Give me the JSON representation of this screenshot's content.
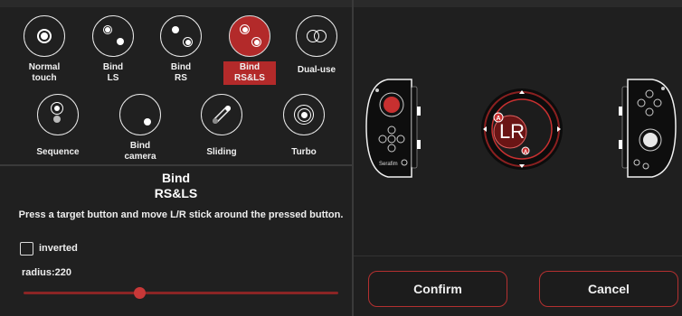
{
  "modes": [
    {
      "id": "normal-touch",
      "label_lines": [
        "Normal",
        "touch"
      ]
    },
    {
      "id": "bind-ls",
      "label_lines": [
        "Bind",
        "LS"
      ]
    },
    {
      "id": "bind-rs",
      "label_lines": [
        "Bind",
        "RS"
      ]
    },
    {
      "id": "bind-rs-ls",
      "label_lines": [
        "Bind",
        "RS&LS"
      ],
      "selected": true
    },
    {
      "id": "dual-use",
      "label_lines": [
        "Dual-use"
      ]
    },
    {
      "id": "sequence",
      "label_lines": [
        "Sequence"
      ]
    },
    {
      "id": "bind-camera",
      "label_lines": [
        "Bind",
        "camera"
      ]
    },
    {
      "id": "sliding",
      "label_lines": [
        "Sliding"
      ]
    },
    {
      "id": "turbo",
      "label_lines": [
        "Turbo"
      ]
    }
  ],
  "description": {
    "title_line1": "Bind",
    "title_line2": "RS&LS",
    "text": "Press a target button and move L/R stick around the pressed button."
  },
  "options": {
    "inverted_label": "inverted",
    "inverted_checked": false,
    "radius_label": "radius:220",
    "radius_fraction": 0.37
  },
  "preview": {
    "center_label": "LR",
    "badge_letter": "A",
    "left_controller_brand": "Serafim"
  },
  "actions": {
    "confirm_label": "Confirm",
    "cancel_label": "Cancel"
  },
  "colors": {
    "accent": "#b32a2a",
    "background": "#1e1e1e"
  }
}
